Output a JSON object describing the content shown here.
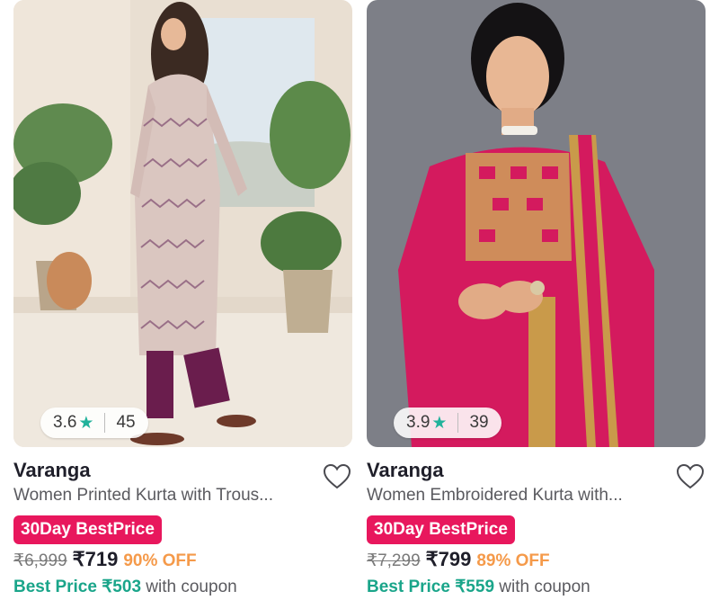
{
  "products": [
    {
      "rating": "3.6",
      "rating_count": "45",
      "brand": "Varanga",
      "title": "Women Printed Kurta with Trous...",
      "badge": "30Day BestPrice",
      "mrp": "₹6,999",
      "price": "₹719",
      "discount": "90% OFF",
      "best_price_label": "Best Price ₹503",
      "best_price_suffix": "with coupon"
    },
    {
      "rating": "3.9",
      "rating_count": "39",
      "brand": "Varanga",
      "title": "Women Embroidered Kurta with...",
      "badge": "30Day BestPrice",
      "mrp": "₹7,299",
      "price": "₹799",
      "discount": "89% OFF",
      "best_price_label": "Best Price ₹559",
      "best_price_suffix": "with coupon"
    }
  ],
  "colors": {
    "badge": "#e8175d",
    "discount": "#f59a4a",
    "best_price": "#1aa58a",
    "star": "#21b29b"
  },
  "icons": {
    "rating": "star-icon",
    "wishlist": "heart-outline-icon"
  }
}
